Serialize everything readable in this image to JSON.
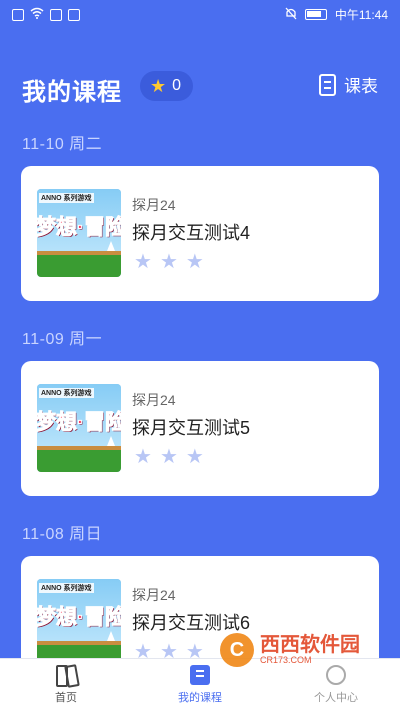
{
  "status_bar": {
    "time": "中午11:44"
  },
  "header": {
    "title": "我的课程",
    "star_count": "0",
    "schedule_label": "课表"
  },
  "sections": [
    {
      "date": "11-10 周二",
      "course": {
        "author": "探月24",
        "name": "探月交互测试4",
        "thumb_tag": "ANNO 系列游戏",
        "thumb_title": "梦想·冒险",
        "stars": 3
      }
    },
    {
      "date": "11-09 周一",
      "course": {
        "author": "探月24",
        "name": "探月交互测试5",
        "thumb_tag": "ANNO 系列游戏",
        "thumb_title": "梦想·冒险",
        "stars": 3
      }
    },
    {
      "date": "11-08 周日",
      "course": {
        "author": "探月24",
        "name": "探月交互测试6",
        "thumb_tag": "ANNO 系列游戏",
        "thumb_title": "梦想·冒险",
        "stars": 3
      }
    }
  ],
  "bottom_nav": {
    "items": [
      {
        "label": "首页",
        "icon": "home-icon",
        "active": false
      },
      {
        "label": "我的课程",
        "icon": "courses-icon",
        "active": true
      },
      {
        "label": "个人中心",
        "icon": "profile-icon",
        "active": false
      }
    ]
  },
  "watermark": {
    "text": "西西软件园",
    "sub": "CR173.COM"
  },
  "colors": {
    "background": "#4a6ef0",
    "star_active": "#ffc930",
    "star_inactive": "#b8c6f5",
    "nav_active": "#4a6ef0"
  }
}
